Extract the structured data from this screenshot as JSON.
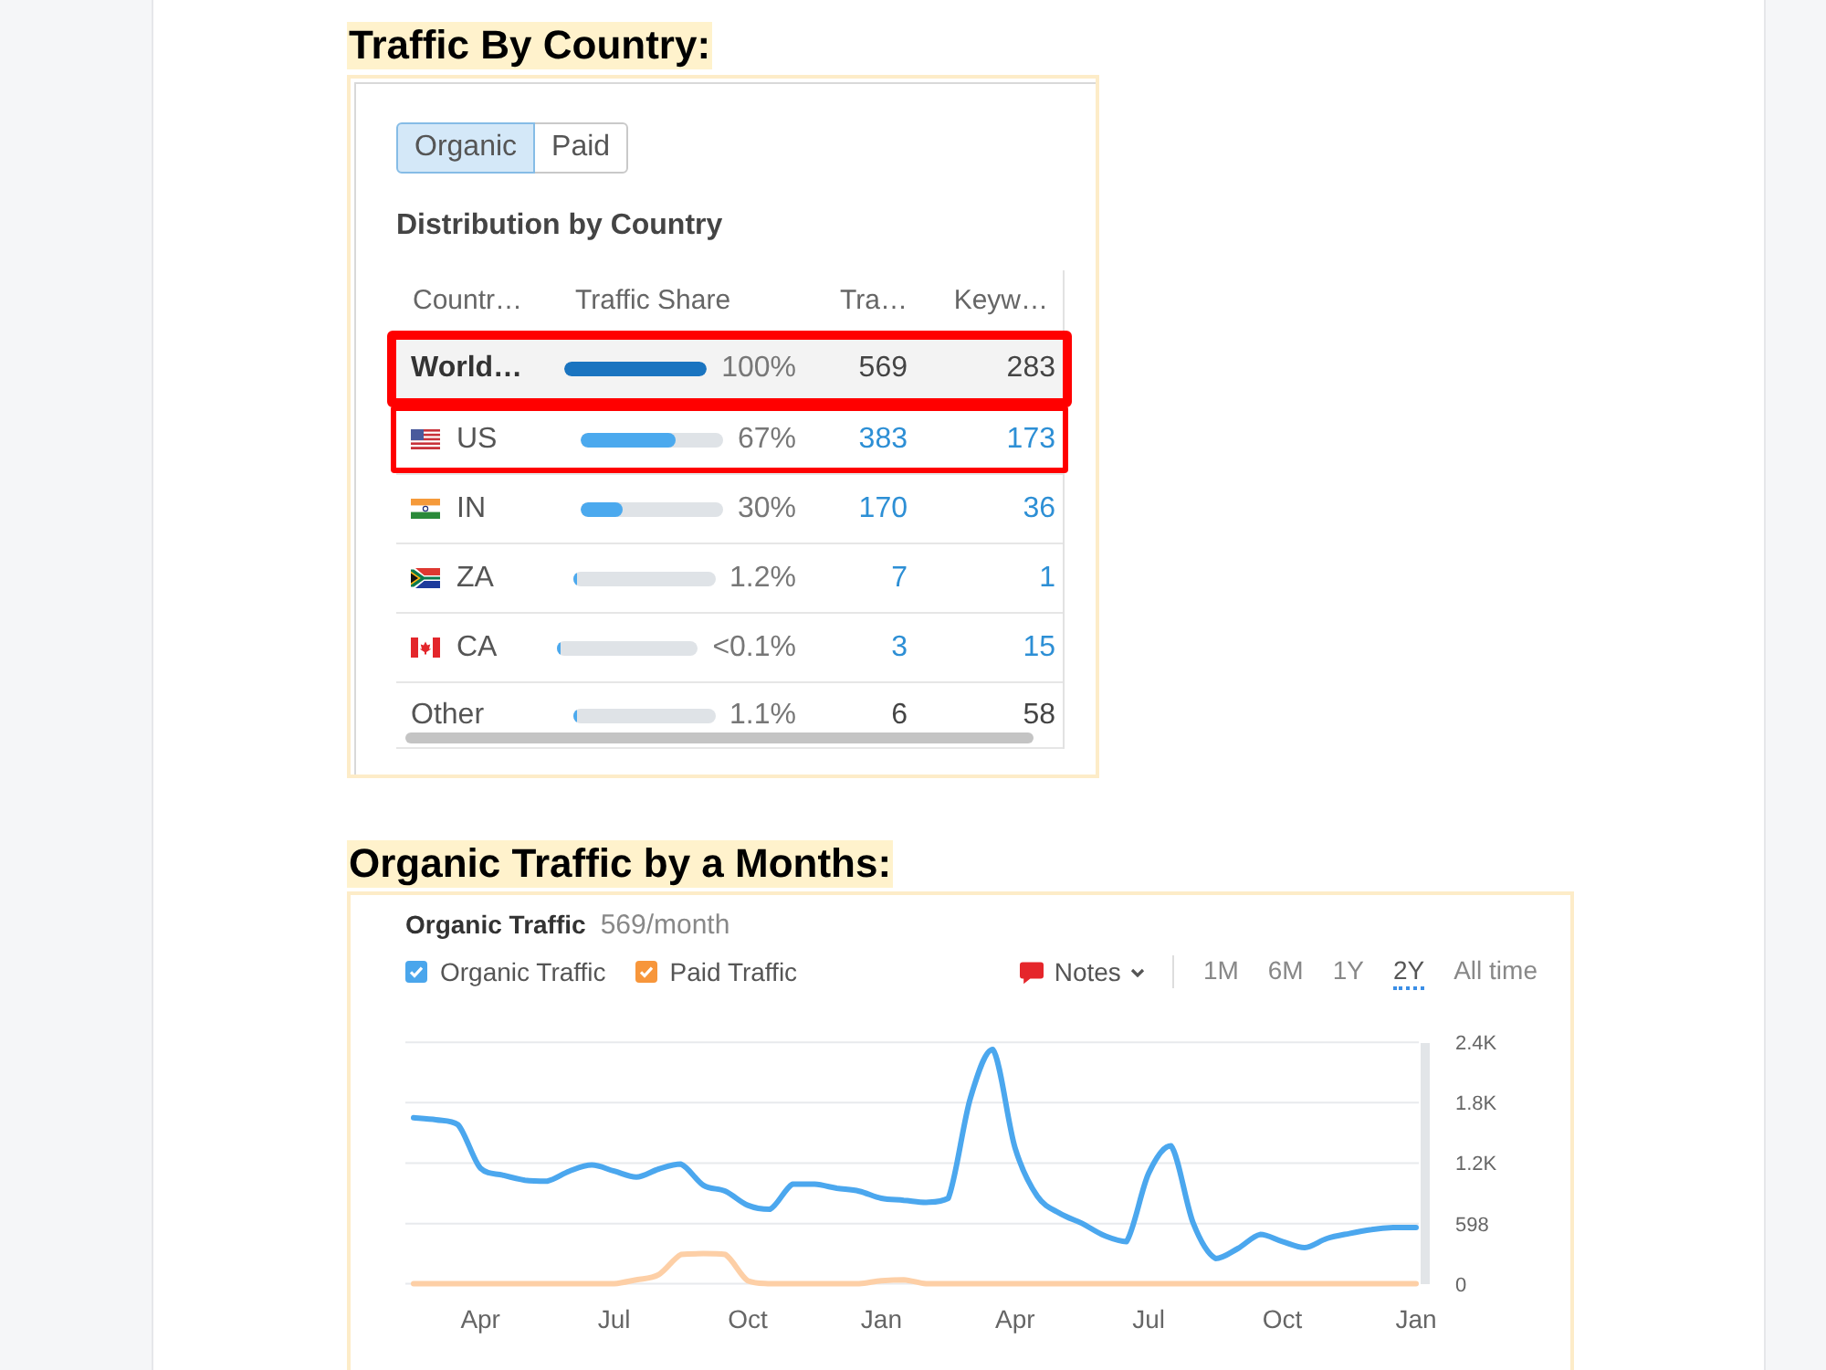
{
  "country_section": {
    "heading": "Traffic By Country:",
    "toggle": [
      {
        "label": "Organic",
        "selected": true
      },
      {
        "label": "Paid",
        "selected": false
      }
    ],
    "title": "Distribution by Country",
    "table": {
      "columns": [
        "Countr…",
        "Traffic Share",
        "Tra…",
        "Keyw…"
      ],
      "rows": [
        {
          "kind": "total",
          "country": "World…",
          "level": 1,
          "share": "100%",
          "traffic": "569",
          "keywords": "283",
          "highlighted": true
        },
        {
          "kind": "country",
          "country": "US",
          "level": 0.67,
          "share": "67%",
          "traffic": "383",
          "keywords": "173",
          "highlighted": true
        },
        {
          "kind": "country",
          "country": "IN",
          "level": 0.3,
          "share": "30%",
          "traffic": "170",
          "keywords": "36",
          "highlighted": false
        },
        {
          "kind": "country",
          "country": "ZA",
          "level": 0.012,
          "share": "1.2%",
          "traffic": "7",
          "keywords": "1",
          "highlighted": false
        },
        {
          "kind": "country",
          "country": "CA",
          "level": 0.001,
          "share": "<0.1%",
          "traffic": "3",
          "keywords": "15",
          "highlighted": false
        },
        {
          "kind": "other",
          "country": "Other",
          "level": 0.011,
          "share": "1.1%",
          "traffic": "6",
          "keywords": "58",
          "highlighted": false
        }
      ]
    }
  },
  "traffic_section": {
    "heading": "Organic Traffic by a Months:",
    "title": "Organic Traffic",
    "value": "569/month",
    "legend": [
      {
        "label": "Organic Traffic",
        "checked": true,
        "color": "#4aa6ec"
      },
      {
        "label": "Paid Traffic",
        "checked": true,
        "color": "#f7963b"
      }
    ],
    "notes": "Notes",
    "periods": [
      {
        "label": "1M",
        "selected": false
      },
      {
        "label": "6M",
        "selected": false
      },
      {
        "label": "1Y",
        "selected": false
      },
      {
        "label": "2Y",
        "selected": true
      },
      {
        "label": "All time",
        "selected": false
      }
    ],
    "chart_data": {
      "type": "line",
      "categories": [
        null,
        null,
        null,
        "Apr",
        null,
        null,
        null,
        null,
        null,
        "Jul",
        null,
        null,
        null,
        null,
        null,
        "Oct",
        null,
        null,
        null,
        null,
        null,
        "Jan",
        null,
        null,
        null,
        null,
        null,
        "Apr",
        null,
        null,
        null,
        null,
        null,
        "Jul",
        null,
        null,
        null,
        null,
        null,
        "Oct",
        null,
        null,
        null,
        null,
        null,
        "Jan"
      ],
      "series": [
        {
          "color": "#4ba7ee",
          "values": [
            1650,
            1630,
            1580,
            1150,
            1080,
            1030,
            1020,
            1120,
            1180,
            1120,
            1060,
            1140,
            1190,
            980,
            920,
            780,
            740,
            990,
            990,
            950,
            920,
            850,
            830,
            810,
            850,
            1850,
            2330,
            1350,
            870,
            700,
            600,
            480,
            420,
            1100,
            1370,
            600,
            250,
            350,
            490,
            420,
            360,
            450,
            500,
            540,
            560,
            560
          ]
        },
        {
          "color": "#fdcfa6",
          "values": [
            0,
            0,
            0,
            0,
            0,
            0,
            0,
            0,
            0,
            0,
            40,
            90,
            290,
            300,
            290,
            30,
            0,
            0,
            0,
            0,
            0,
            30,
            40,
            0,
            0,
            0,
            0,
            0,
            0,
            0,
            0,
            0,
            0,
            0,
            0,
            0,
            0,
            0,
            0,
            0,
            0,
            0,
            0,
            0,
            0,
            0
          ]
        }
      ],
      "ylim": [
        0,
        2400
      ],
      "yticks": [
        0,
        {
          "value": 598,
          "label": "598"
        },
        {
          "value": 1200,
          "label": "1.2K"
        },
        {
          "value": 1800,
          "label": "1.8K"
        },
        {
          "value": 2400,
          "label": "2.4K"
        }
      ],
      "grid": true
    }
  }
}
